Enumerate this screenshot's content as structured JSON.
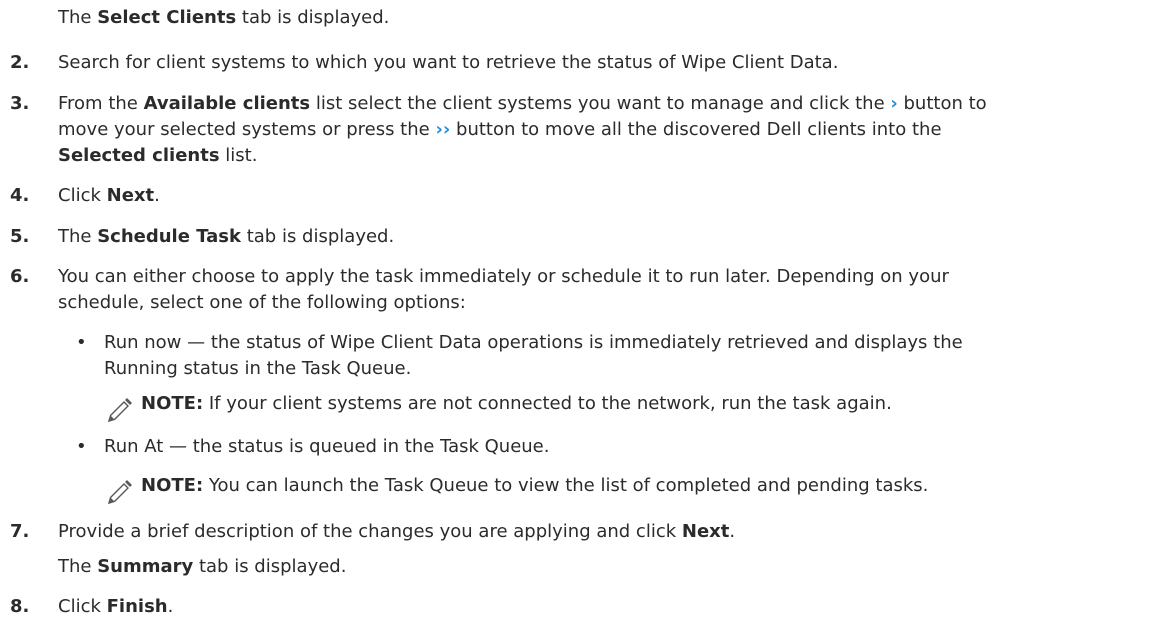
{
  "accent_color": "#1f8fd8",
  "intro": {
    "pre": "The ",
    "bold": "Select Clients",
    "post": " tab is displayed."
  },
  "steps": {
    "s2": {
      "num": "2.",
      "text": "Search for client systems to which you want to retrieve the status of Wipe Client Data."
    },
    "s3": {
      "num": "3.",
      "l1_pre": "From the ",
      "l1_bold": "Available clients",
      "l1_mid": " list select the client systems you want to manage and click the ",
      "l1_chev": "›",
      "l1_post": " button to",
      "l2_pre": "move your selected systems or press the ",
      "l2_chev": "››",
      "l2_post": " button to move all the discovered Dell clients into the",
      "l3_bold": "Selected clients",
      "l3_post": " list."
    },
    "s4": {
      "num": "4.",
      "pre": "Click ",
      "bold": "Next",
      "post": "."
    },
    "s5": {
      "num": "5.",
      "pre": "The ",
      "bold": "Schedule Task",
      "post": " tab is displayed."
    },
    "s6": {
      "num": "6.",
      "l1": "You can either choose to apply the task immediately or schedule it to run later. Depending on your",
      "l2": "schedule, select one of the following options:",
      "opt1_bullet": "•",
      "opt1_l1": "Run now — the status of Wipe Client Data operations is immediately retrieved and displays the",
      "opt1_l2": "Running status in the Task Queue.",
      "note1_label": "NOTE:",
      "note1_text": " If your client systems are not connected to the network, run the task again.",
      "opt2_bullet": "•",
      "opt2": "Run At — the status is queued in the Task Queue.",
      "note2_label": "NOTE:",
      "note2_text": " You can launch the Task Queue to view the list of completed and pending tasks."
    },
    "s7": {
      "num": "7.",
      "l1_pre": "Provide a brief description of the changes you are applying and click ",
      "l1_bold": "Next",
      "l1_post": ".",
      "l2_pre": "The ",
      "l2_bold": "Summary",
      "l2_post": " tab is displayed."
    },
    "s8": {
      "num": "8.",
      "pre": "Click ",
      "bold": "Finish",
      "post": "."
    }
  }
}
